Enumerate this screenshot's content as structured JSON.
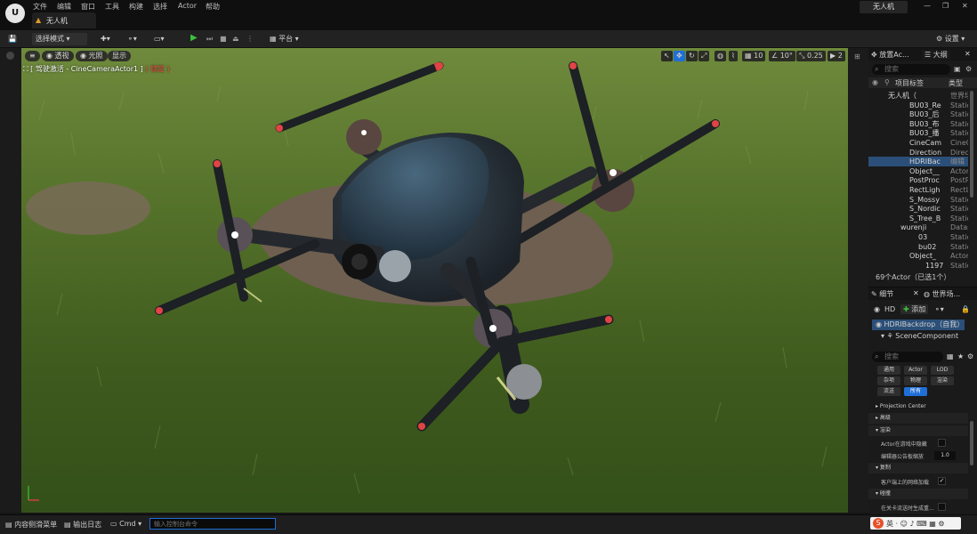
{
  "menu": [
    "文件",
    "编辑",
    "窗口",
    "工具",
    "构建",
    "选择",
    "Actor",
    "帮助"
  ],
  "project_tab": "无人机",
  "project_name_button": "无人机",
  "window_controls": [
    "—",
    "❐",
    "✕"
  ],
  "toolbar": {
    "select_mode": "选择模式",
    "platform": "平台",
    "settings": "设置"
  },
  "viewport": {
    "perspective": "透视",
    "lighting": "光照",
    "show": "显示",
    "camera_prefix": "[ 驾驶激活 - CineCameraActor1 ]",
    "camera_locked": "( 锁定 )",
    "grid_snap": "10",
    "rotation_snap": "10°",
    "scale_snap": "0.25",
    "camera_speed": "2"
  },
  "outliner": {
    "tab_place": "放置Ac...",
    "tab_outliner": "大纲",
    "search_placeholder": "搜索",
    "col_label": "项目标签",
    "col_type": "类型",
    "rows": [
      {
        "name": "无人机（",
        "type": "世界场",
        "indent": 22
      },
      {
        "name": "BU03_Re",
        "type": "Static",
        "indent": 46
      },
      {
        "name": "BU03_后",
        "type": "Static",
        "indent": 46
      },
      {
        "name": "BU03_布",
        "type": "Static",
        "indent": 46
      },
      {
        "name": "BU03_播",
        "type": "Static",
        "indent": 46
      },
      {
        "name": "CineCam",
        "type": "CineC",
        "indent": 46
      },
      {
        "name": "Direction",
        "type": "Direct",
        "indent": 46
      },
      {
        "name": "HDRIBac",
        "type": "编辑",
        "indent": 46
      },
      {
        "name": "Object__",
        "type": "Actor",
        "indent": 46
      },
      {
        "name": "PostProc",
        "type": "PostP",
        "indent": 46
      },
      {
        "name": "RectLigh",
        "type": "RectL",
        "indent": 46
      },
      {
        "name": "S_Mossy",
        "type": "Static",
        "indent": 46
      },
      {
        "name": "S_Nordic",
        "type": "Static",
        "indent": 46
      },
      {
        "name": "S_Tree_B",
        "type": "Static",
        "indent": 46
      },
      {
        "name": "wurenji",
        "type": "Datas",
        "indent": 36
      },
      {
        "name": "03",
        "type": "Static",
        "indent": 56
      },
      {
        "name": "bu02",
        "type": "Static",
        "indent": 56
      },
      {
        "name": "Object_",
        "type": "Actor",
        "indent": 46
      },
      {
        "name": "1197",
        "type": "Static",
        "indent": 64
      }
    ],
    "actor_count": "69个Actor（已选1个）"
  },
  "details": {
    "tab_details": "细节",
    "tab_world": "世界场...",
    "actor_short": "HD",
    "add_label": "添加",
    "selected_actor": "HDRIBackdrop（自我）",
    "scene_component": "SceneComponent",
    "search_placeholder": "搜索",
    "filters": [
      "通用",
      "Actor",
      "LOD",
      "杂项",
      "物理",
      "渲染",
      "流送",
      "所有"
    ],
    "active_filter": "所有",
    "projection_center": "Projection Center",
    "sections": [
      "高级",
      "渲染",
      "复制",
      "碰撞"
    ],
    "props": {
      "hidden_in_game": "Actor在游戏中隐藏",
      "billboard_scale": "编辑器公告板缩放",
      "billboard_value": "1.0",
      "net_load": "客户端上的网络加载",
      "spawn_collision": "在关卡流送时生成重..."
    }
  },
  "bottom": {
    "content_drawer": "内容侧滑菜单",
    "output_log": "输出日志",
    "cmd": "Cmd",
    "cmd_placeholder": "输入控制台命令"
  },
  "colors": {
    "accent": "#1f6fd6",
    "play_green": "#3cc13c",
    "locked_red": "#ff4a4a",
    "selection": "#2b4f78"
  }
}
